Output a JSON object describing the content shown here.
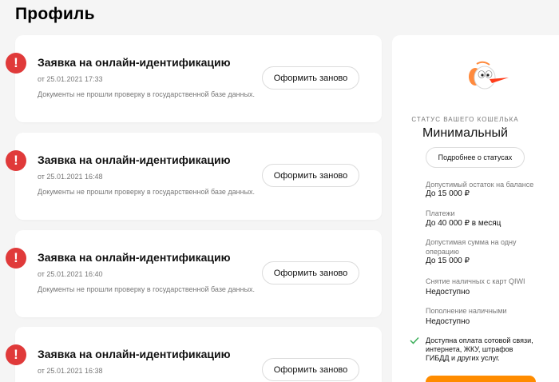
{
  "page": {
    "title": "Профиль"
  },
  "requests": [
    {
      "title": "Заявка на онлайн-идентификацию",
      "date": "от 25.01.2021 17:33",
      "description": "Документы не прошли проверку в государственной базе данных.",
      "button": "Оформить заново",
      "icon": "alert-icon"
    },
    {
      "title": "Заявка на онлайн-идентификацию",
      "date": "от 25.01.2021 16:48",
      "description": "Документы не прошли проверку в государственной базе данных.",
      "button": "Оформить заново",
      "icon": "alert-icon"
    },
    {
      "title": "Заявка на онлайн-идентификацию",
      "date": "от 25.01.2021 16:40",
      "description": "Документы не прошли проверку в государственной базе данных.",
      "button": "Оформить заново",
      "icon": "alert-icon"
    },
    {
      "title": "Заявка на онлайн-идентификацию",
      "date": "от 25.01.2021 16:38",
      "description": "",
      "button": "Оформить заново",
      "icon": "alert-icon"
    }
  ],
  "wallet": {
    "status_caption": "СТАТУС ВАШЕГО КОШЕЛЬКА",
    "status_value": "Минимальный",
    "status_button": "Подробнее о статусах",
    "limits": [
      {
        "label": "Допустимый остаток на балансе",
        "value": "До 15 000 ₽"
      },
      {
        "label": "Платежи",
        "value": "До 40 000 ₽ в месяц"
      },
      {
        "label": "Допустимая сумма на одну операцию",
        "value": "До 15 000 ₽"
      },
      {
        "label": "Снятие наличных с карт QIWI",
        "value": "Недоступно"
      },
      {
        "label": "Пополнение наличными",
        "value": "Недоступно"
      }
    ],
    "available_note": "Доступна оплата сотовой связи, интернета, ЖКУ, штрафов ГИБДД и других услуг.",
    "mascot_icon": "qiwi-bird-mascot-icon",
    "check_icon": "check-icon"
  },
  "colors": {
    "alert": "#e03a3a",
    "accent": "#ff8c00",
    "check": "#3cae5a",
    "background": "#f5f5f5"
  }
}
